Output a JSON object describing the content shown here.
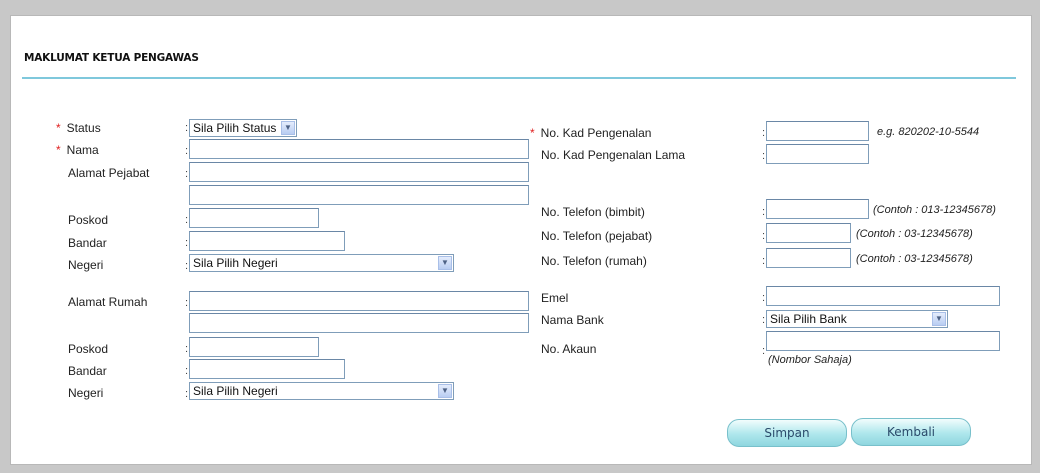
{
  "section_title": "MAKLUMAT KETUA PENGAWAS",
  "colon": ":",
  "required_mark": "*",
  "left": {
    "status_label": "Status",
    "status_value": "Sila Pilih Status",
    "nama_label": "Nama",
    "alamat_pejabat_label": "Alamat Pejabat",
    "poskod_label": "Poskod",
    "bandar_label": "Bandar",
    "negeri_label": "Negeri",
    "negeri_value": "Sila Pilih Negeri",
    "alamat_rumah_label": "Alamat Rumah",
    "poskod2_label": "Poskod",
    "bandar2_label": "Bandar",
    "negeri2_label": "Negeri",
    "negeri2_value": "Sila Pilih Negeri"
  },
  "right": {
    "ic_label": "No. Kad Pengenalan",
    "ic_hint": "e.g. 820202-10-5544",
    "ic_old_label": "No. Kad Pengenalan Lama",
    "tel_bimbit_label": "No. Telefon (bimbit)",
    "tel_bimbit_hint": "(Contoh : 013-12345678)",
    "tel_pejabat_label": "No. Telefon (pejabat)",
    "tel_pejabat_hint": "(Contoh : 03-12345678)",
    "tel_rumah_label": "No. Telefon (rumah)",
    "tel_rumah_hint": "(Contoh : 03-12345678)",
    "emel_label": "Emel",
    "bank_label": "Nama Bank",
    "bank_value": "Sila Pilih Bank",
    "akaun_label": "No. Akaun",
    "akaun_hint": "(Nombor Sahaja)"
  },
  "buttons": {
    "save": "Simpan",
    "back": "Kembali"
  },
  "icons": {
    "dropdown": "chevron-down-icon"
  }
}
